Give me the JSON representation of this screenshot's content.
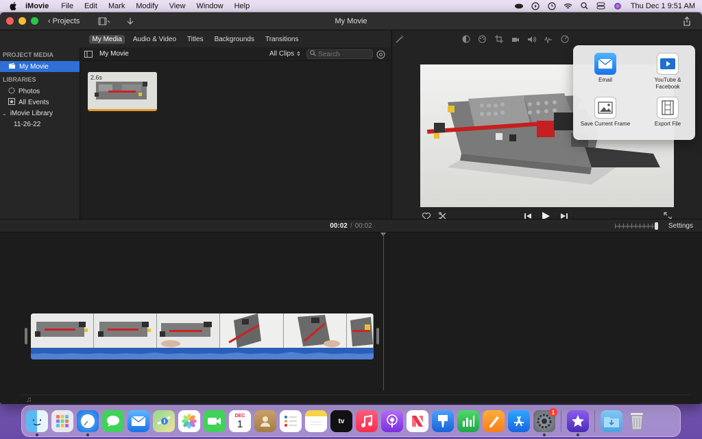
{
  "menubar": {
    "app_name": "iMovie",
    "items": [
      "File",
      "Edit",
      "Mark",
      "Modify",
      "View",
      "Window",
      "Help"
    ],
    "clock": "Thu Dec 1  9:51 AM"
  },
  "window": {
    "title": "My Movie",
    "projects_label": "Projects"
  },
  "browser_tabs": [
    "My Media",
    "Audio & Video",
    "Titles",
    "Backgrounds",
    "Transitions"
  ],
  "sidebar": {
    "project_media_heading": "PROJECT MEDIA",
    "project_item": "My Movie",
    "libraries_heading": "LIBRARIES",
    "library_items": [
      "Photos",
      "All Events"
    ],
    "library_name": "iMovie Library",
    "event_name": "11-26-22"
  },
  "media": {
    "title": "My Movie",
    "clips_filter": "All Clips",
    "search_placeholder": "Search",
    "thumbnail_duration": "2.6s"
  },
  "share_popover": {
    "options": [
      "Email",
      "YouTube & Facebook",
      "Save Current Frame",
      "Export File"
    ]
  },
  "timebar": {
    "current": "00:02",
    "separator": "/",
    "total": "00:02",
    "settings_label": "Settings"
  },
  "dock": {
    "apps": [
      "Finder",
      "Launchpad",
      "Safari",
      "Messages",
      "Mail",
      "Maps",
      "Photos",
      "FaceTime",
      "Calendar",
      "Contacts",
      "Reminders",
      "Notes",
      "TV",
      "Music",
      "Podcasts",
      "News",
      "Keynote",
      "Numbers",
      "Pages",
      "App Store",
      "System Preferences",
      "iMovie",
      "Downloads",
      "Trash"
    ],
    "calendar_month": "DEC",
    "calendar_day": "1",
    "tv_label": "tv",
    "system_prefs_badge": "1"
  },
  "colors": {
    "selection": "#2f6fd6",
    "audio_track": "#2a5fb8",
    "clip_border": "#e39a2a"
  }
}
